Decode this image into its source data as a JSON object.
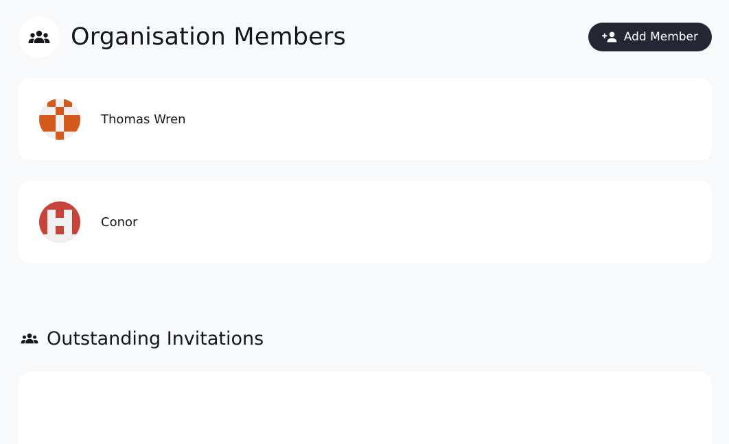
{
  "header": {
    "title": "Organisation Members",
    "icon": "group-icon",
    "add_button_label": "Add Member",
    "add_button_icon": "person-add-icon"
  },
  "members": [
    {
      "name": "Thomas Wren",
      "avatar_color": "#d4591c",
      "avatar_bg": "#f0f0f0"
    },
    {
      "name": "Conor",
      "avatar_color": "#c8433a",
      "avatar_bg": "#f0f0f0"
    }
  ],
  "invitations": {
    "title": "Outstanding Invitations",
    "icon": "group-icon"
  },
  "colors": {
    "page_bg": "#f8f9fb",
    "card_bg": "#ffffff",
    "button_bg": "#222733",
    "text": "#15171c"
  }
}
